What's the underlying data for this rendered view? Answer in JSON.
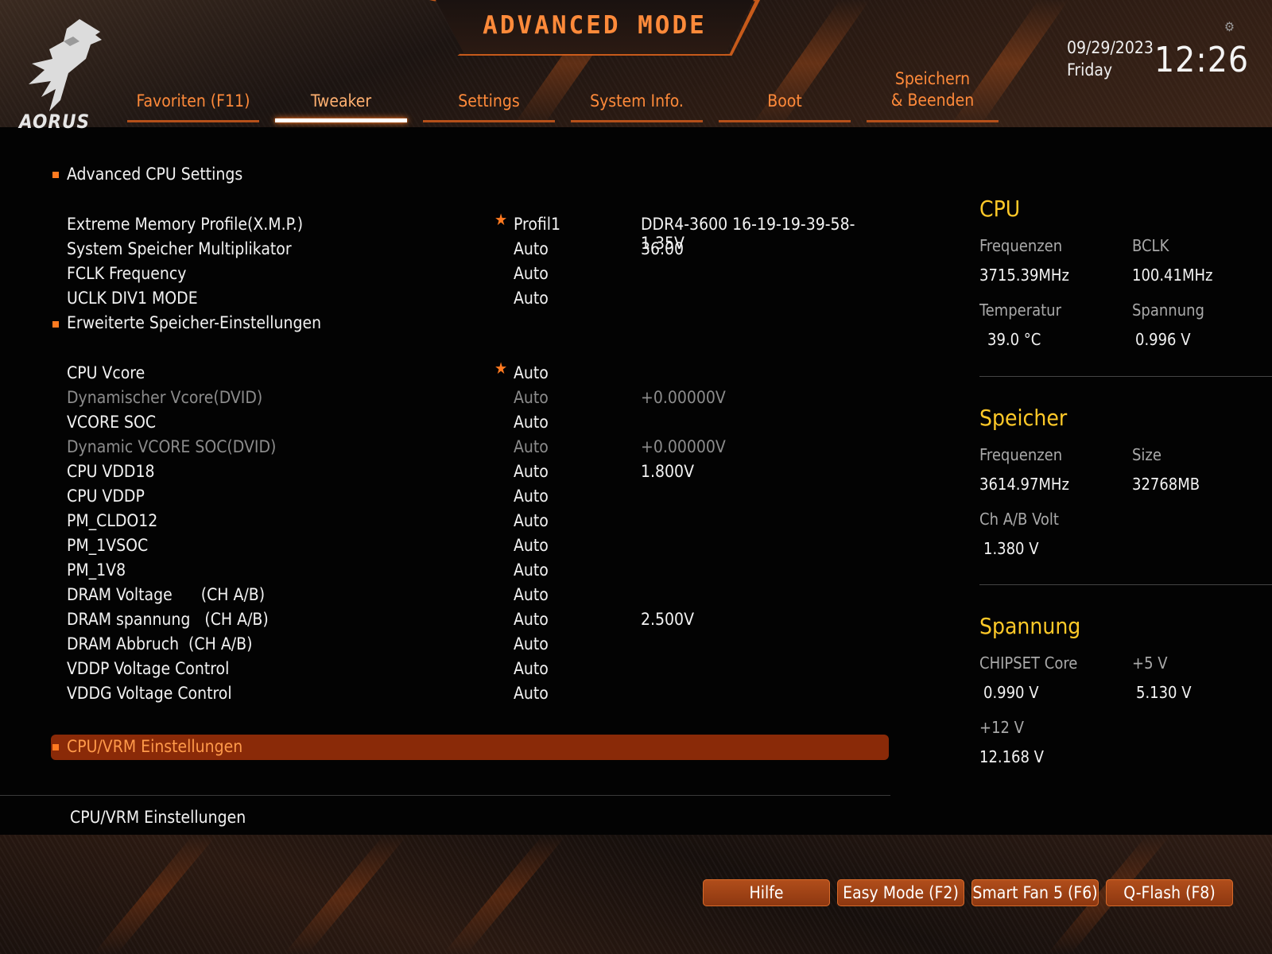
{
  "header": {
    "title": "ADVANCED MODE",
    "logo_text": "AORUS",
    "date": "09/29/2023",
    "day": "Friday",
    "time": "12:26"
  },
  "tabs": [
    {
      "label": "Favoriten (F11)",
      "active": false
    },
    {
      "label": "Tweaker",
      "active": true
    },
    {
      "label": "Settings",
      "active": false
    },
    {
      "label": "System Info.",
      "active": false
    },
    {
      "label": "Boot",
      "active": false
    },
    {
      "label": "Speichern\n& Beenden",
      "active": false
    }
  ],
  "main": {
    "section_cpu": "Advanced CPU Settings",
    "rows_memory": [
      {
        "label": "Extreme Memory Profile(X.M.P.)",
        "value": "Profil1",
        "info": "DDR4-3600 16-19-19-39-58-1.35V",
        "star": "★"
      },
      {
        "label": "System Speicher Multiplikator",
        "value": "Auto",
        "info": "36.00"
      },
      {
        "label": "FCLK Frequency",
        "value": "Auto",
        "info": ""
      },
      {
        "label": "UCLK DIV1 MODE",
        "value": "Auto",
        "info": ""
      }
    ],
    "section_mem": "Erweiterte Speicher-Einstellungen",
    "rows_voltage": [
      {
        "label": "CPU Vcore",
        "value": "Auto",
        "info": "",
        "star": "★"
      },
      {
        "label": "Dynamischer Vcore(DVID)",
        "value": "Auto",
        "info": "+0.00000V"
      },
      {
        "label": "VCORE SOC",
        "value": "Auto",
        "info": ""
      },
      {
        "label": "Dynamic VCORE SOC(DVID)",
        "value": "Auto",
        "info": "+0.00000V"
      },
      {
        "label": "CPU VDD18",
        "value": "Auto",
        "info": "1.800V"
      },
      {
        "label": "CPU VDDP",
        "value": "Auto",
        "info": ""
      },
      {
        "label": "PM_CLDO12",
        "value": "Auto",
        "info": ""
      },
      {
        "label": "PM_1VSOC",
        "value": "Auto",
        "info": ""
      },
      {
        "label": "PM_1V8",
        "value": "Auto",
        "info": ""
      },
      {
        "label": "DRAM Voltage      (CH A/B)",
        "value": "Auto",
        "info": ""
      },
      {
        "label": "DRAM spannung   (CH A/B)",
        "value": "Auto",
        "info": "2.500V"
      },
      {
        "label": "DRAM Abbruch  (CH A/B)",
        "value": "Auto",
        "info": ""
      },
      {
        "label": "VDDP Voltage Control",
        "value": "Auto",
        "info": ""
      },
      {
        "label": "VDDG Voltage Control",
        "value": "Auto",
        "info": ""
      }
    ],
    "selected_item": "CPU/VRM Einstellungen",
    "help_text": "CPU/VRM Einstellungen"
  },
  "panel": {
    "cpu": {
      "title": "CPU",
      "freq_label": "Frequenzen",
      "freq_value": "3715.39MHz",
      "bclk_label": "BCLK",
      "bclk_value": "100.41MHz",
      "temp_label": "Temperatur",
      "temp_value": "39.0 °C",
      "volt_label": "Spannung",
      "volt_value": "0.996 V"
    },
    "memory": {
      "title": "Speicher",
      "freq_label": "Frequenzen",
      "freq_value": "3614.97MHz",
      "size_label": "Size",
      "size_value": "32768MB",
      "volt_label": "Ch A/B Volt",
      "volt_value": "1.380 V"
    },
    "voltage": {
      "title": "Spannung",
      "chipset_label": "CHIPSET Core",
      "chipset_value": "0.990 V",
      "p5_label": "+5 V",
      "p5_value": "5.130 V",
      "p12_label": "+12 V",
      "p12_value": "12.168 V"
    }
  },
  "footer": {
    "buttons": [
      "Hilfe",
      "Easy Mode (F2)",
      "Smart Fan 5 (F6)",
      "Q-Flash (F8)"
    ]
  },
  "colors": {
    "accent": "#ff8a3a",
    "panel_title": "#ffc928",
    "selected_bar": "#8a2a08",
    "button": "#b24e1b"
  }
}
